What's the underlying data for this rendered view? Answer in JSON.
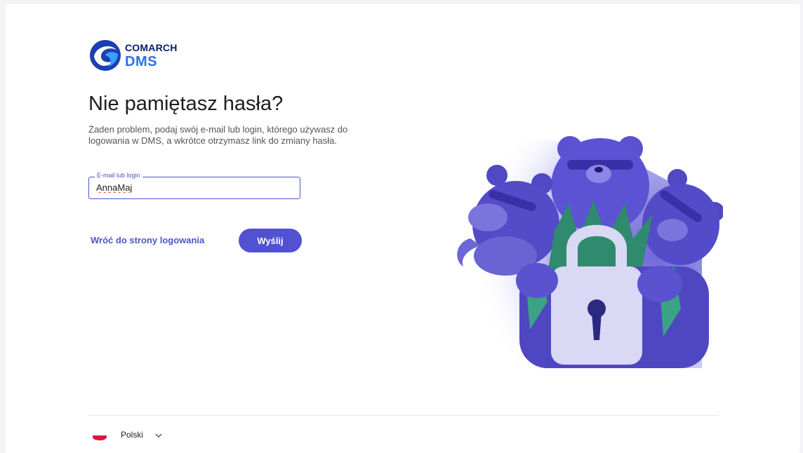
{
  "brand": {
    "line1": "COMARCH",
    "line2": "DMS"
  },
  "page": {
    "title": "Nie pamiętasz hasła?",
    "subtitle": "Żaden problem, podaj swój e-mail lub login, którego używasz do logowania w DMS, a wkrótce otrzymasz link do zmiany hasła."
  },
  "form": {
    "field_label": "E-mail lub login",
    "field_value": "AnnaMaj",
    "back_link": "Wróć do strony logowania",
    "submit_label": "Wyślij"
  },
  "footer": {
    "language": "Polski"
  },
  "colors": {
    "accent": "#5151d1",
    "brand_dark": "#0b1b6b",
    "brand_blue": "#2d6fe6"
  },
  "icons": {
    "logo": "comarch-logo-icon",
    "flag": "poland-flag-icon",
    "chevron": "chevron-down-icon"
  }
}
